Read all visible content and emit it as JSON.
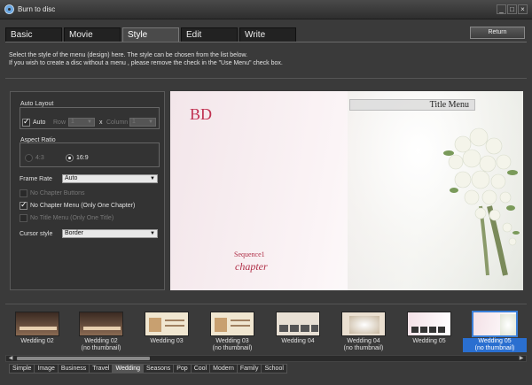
{
  "window": {
    "title": "Burn to disc",
    "icon": "disc-burner-icon"
  },
  "tabs": [
    {
      "label": "Basic"
    },
    {
      "label": "Movie"
    },
    {
      "label": "Style"
    },
    {
      "label": "Edit"
    },
    {
      "label": "Write"
    }
  ],
  "active_tab": "Style",
  "return_label": "Return",
  "instructions": {
    "line1": "Select the style of the menu (design) here. The style can be chosen from the list below.",
    "line2": "If you wish to create a disc without a menu , please remove the check in the \"Use Menu\" check box."
  },
  "auto_layout": {
    "group_title": "Auto Layout",
    "auto_label": "Auto",
    "auto_checked": true,
    "row_label": "Row",
    "row_value": "1",
    "x_label": "x",
    "column_label": "Column",
    "column_value": "1"
  },
  "aspect_ratio": {
    "group_title": "Aspect Ratio",
    "option_43": "4:3",
    "option_169": "16:9",
    "selected": "16:9"
  },
  "frame_rate": {
    "label": "Frame Rate",
    "value": "Auto"
  },
  "options": {
    "no_chapter_buttons": "No Chapter Buttons",
    "no_chapter_menu": "No Chapter Menu (Only One Chapter)",
    "no_title_menu": "No Title Menu (Only One Title)"
  },
  "cursor_style": {
    "label": "Cursor style",
    "value": "Border"
  },
  "preview": {
    "logo": "BD",
    "title_menu": "Title Menu",
    "sequence": "Sequence1",
    "chapter": "chapter"
  },
  "thumbnails": [
    {
      "line1": "Wedding 02",
      "line2": ""
    },
    {
      "line1": "Wedding 02",
      "line2": "(no thumbnail)"
    },
    {
      "line1": "Wedding 03",
      "line2": ""
    },
    {
      "line1": "Wedding 03",
      "line2": "(no thumbnail)"
    },
    {
      "line1": "Wedding 04",
      "line2": ""
    },
    {
      "line1": "Wedding 04",
      "line2": "(no thumbnail)"
    },
    {
      "line1": "Wedding 05",
      "line2": ""
    },
    {
      "line1": "Wedding 05",
      "line2": "(no thumbnail)"
    }
  ],
  "selected_thumbnail": "Wedding 05 (no thumbnail)",
  "categories": [
    "Simple",
    "Image",
    "Business",
    "Travel",
    "Wedding",
    "Seasons",
    "Pop",
    "Cool",
    "Modern",
    "Family",
    "School"
  ],
  "active_category": "Wedding",
  "colors": {
    "accent_selected": "#2a6fd0",
    "brand_pink": "#c03050"
  }
}
